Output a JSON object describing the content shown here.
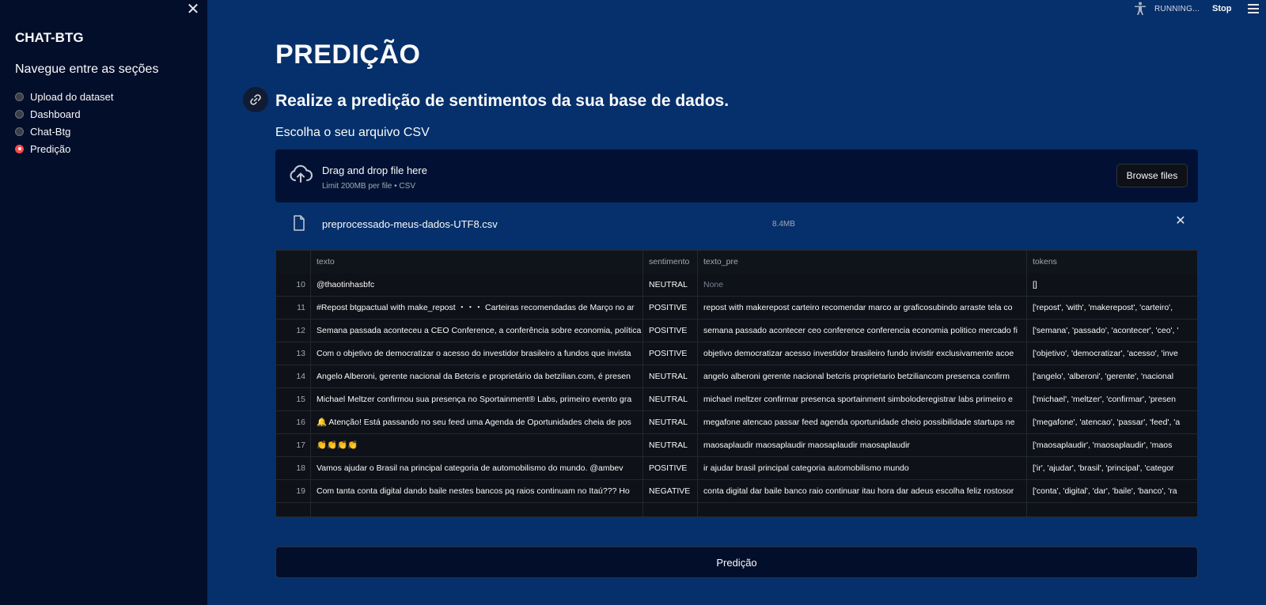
{
  "sidebar": {
    "close_glyph": "✕",
    "title": "CHAT-BTG",
    "subtitle": "Navegue entre as seções",
    "items": [
      {
        "label": "Upload do dataset",
        "selected": false
      },
      {
        "label": "Dashboard",
        "selected": false
      },
      {
        "label": "Chat-Btg",
        "selected": false
      },
      {
        "label": "Predição",
        "selected": true
      }
    ]
  },
  "topbar": {
    "status": "RUNNING...",
    "stop_label": "Stop",
    "icons": [
      "accessibility-icon",
      "menu-icon"
    ]
  },
  "main": {
    "title": "PREDIÇÃO",
    "subheader": "Realize a predição de sentimentos da sua base de dados.",
    "uploader_label": "Escolha o seu arquivo CSV",
    "dropzone": {
      "title": "Drag and drop file here",
      "limit": "Limit 200MB per file • CSV",
      "browse_label": "Browse files"
    },
    "file": {
      "name": "preprocessado-meus-dados-UTF8.csv",
      "size": "8.4MB",
      "remove_glyph": "✕"
    },
    "table": {
      "columns": [
        "",
        "texto",
        "sentimento",
        "texto_pre",
        "tokens"
      ],
      "rows": [
        {
          "idx": "10",
          "texto": "@thaotinhasbfc",
          "sentimento": "NEUTRAL",
          "texto_pre": "None",
          "tokens": "[]"
        },
        {
          "idx": "11",
          "texto": "#Repost btgpactual with make_repost ・・・ Carteiras recomendadas de Março no ar",
          "sentimento": "POSITIVE",
          "texto_pre": "repost with makerepost carteiro recomendar marco ar graficosubindo arraste tela co",
          "tokens": "['repost', 'with', 'makerepost', 'carteiro',"
        },
        {
          "idx": "12",
          "texto": "Semana passada aconteceu a CEO Conference, a conferência sobre economia, política",
          "sentimento": "POSITIVE",
          "texto_pre": "semana passado acontecer ceo conference conferencia economia politico mercado fi",
          "tokens": "['semana', 'passado', 'acontecer', 'ceo', '"
        },
        {
          "idx": "13",
          "texto": "Com o objetivo de democratizar o acesso do investidor brasileiro a fundos que invista",
          "sentimento": "POSITIVE",
          "texto_pre": "objetivo democratizar acesso investidor brasileiro fundo invistir exclusivamente acoe",
          "tokens": "['objetivo', 'democratizar', 'acesso', 'inve"
        },
        {
          "idx": "14",
          "texto": "Angelo Alberoni, gerente nacional da Betcris e proprietário da betzilian.com, é presen",
          "sentimento": "NEUTRAL",
          "texto_pre": "angelo alberoni gerente nacional betcris proprietario betziliancom presenca confirm",
          "tokens": "['angelo', 'alberoni', 'gerente', 'nacional"
        },
        {
          "idx": "15",
          "texto": "Michael Meltzer confirmou sua presença no Sportainment® Labs, primeiro evento gra",
          "sentimento": "NEUTRAL",
          "texto_pre": "michael meltzer confirmar presenca sportainment simboloderegistrar labs primeiro e",
          "tokens": "['michael', 'meltzer', 'confirmar', 'presen"
        },
        {
          "idx": "16",
          "texto": "🔔 Atenção! Está passando no seu feed uma Agenda de Oportunidades cheia de pos",
          "sentimento": "NEUTRAL",
          "texto_pre": "megafone atencao passar feed agenda oportunidade cheio possibilidade startups ne",
          "tokens": "['megafone', 'atencao', 'passar', 'feed', 'a"
        },
        {
          "idx": "17",
          "texto": "👏👏👏👏",
          "sentimento": "NEUTRAL",
          "texto_pre": "maosaplaudir maosaplaudir maosaplaudir maosaplaudir",
          "tokens": "['maosaplaudir', 'maosaplaudir', 'maos"
        },
        {
          "idx": "18",
          "texto": "Vamos ajudar o Brasil na principal categoria de automobilismo do mundo. @ambev",
          "sentimento": "POSITIVE",
          "texto_pre": "ir ajudar brasil principal categoria automobilismo mundo",
          "tokens": "['ir', 'ajudar', 'brasil', 'principal', 'categor"
        },
        {
          "idx": "19",
          "texto": "Com tanta conta digital dando baile nestes bancos pq raios continuam no Itaú??? Ho",
          "sentimento": "NEGATIVE",
          "texto_pre": "conta digital dar baile banco raio continuar itau hora dar adeus escolha feliz rostosor",
          "tokens": "['conta', 'digital', 'dar', 'baile', 'banco', 'ra"
        }
      ]
    },
    "predict_label": "Predição"
  }
}
